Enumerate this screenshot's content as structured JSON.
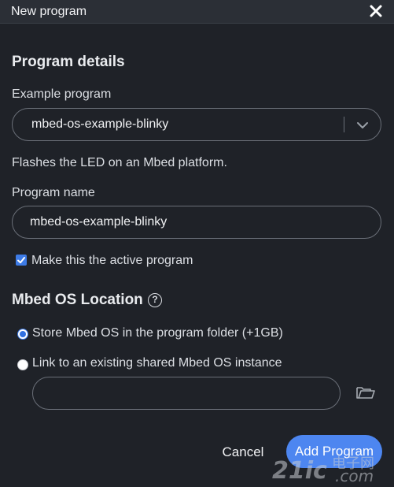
{
  "window": {
    "title": "New program"
  },
  "program_details": {
    "heading": "Program details",
    "example_label": "Example program",
    "example_selected": "mbed-os-example-blinky",
    "example_description": "Flashes the LED on an Mbed platform.",
    "name_label": "Program name",
    "name_value": "mbed-os-example-blinky",
    "active_checkbox_label": "Make this the active program",
    "active_checked": true
  },
  "mbed_os_location": {
    "heading": "Mbed OS Location",
    "help_glyph": "?",
    "option_store": "Store Mbed OS in the program folder (+1GB)",
    "option_link": "Link to an existing shared Mbed OS instance",
    "selected": "store",
    "shared_path_value": ""
  },
  "buttons": {
    "cancel": "Cancel",
    "add": "Add Program"
  },
  "watermark": {
    "main": "21ic",
    "sub": "电子网",
    "domain": ".com"
  },
  "colors": {
    "background": "#1f2228",
    "titlebar": "#2b2f36",
    "accent": "#4d86f0",
    "field_border": "#6a6f78"
  },
  "icons": [
    "close-icon",
    "chevron-down-icon",
    "help-icon",
    "folder-open-icon",
    "checkmark-icon"
  ]
}
